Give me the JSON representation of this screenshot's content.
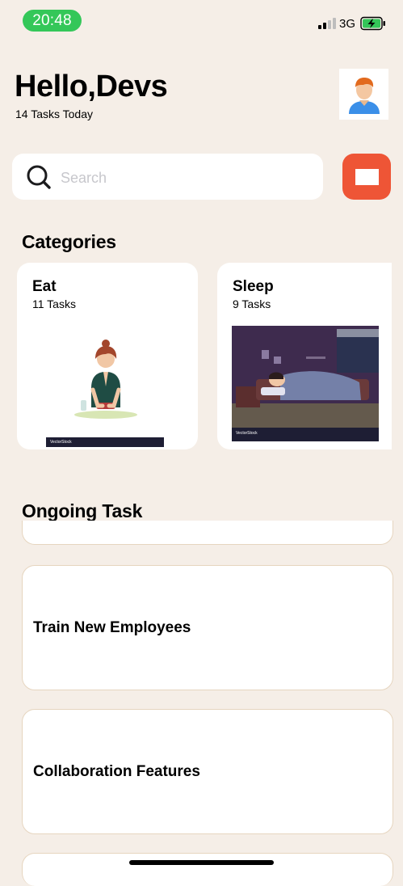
{
  "status_bar": {
    "time": "20:48",
    "network": "3G"
  },
  "header": {
    "greeting": "Hello,Devs",
    "subtitle": "14 Tasks Today"
  },
  "search": {
    "placeholder": "Search",
    "value": ""
  },
  "categories": {
    "title": "Categories",
    "items": [
      {
        "name": "Eat",
        "count": "11 Tasks",
        "watermark": "VectorStock"
      },
      {
        "name": "Sleep",
        "count": "9 Tasks",
        "watermark": "VectorStock"
      }
    ]
  },
  "ongoing": {
    "title": "Ongoing Task",
    "items": [
      {
        "title": "Train New Employees"
      },
      {
        "title": "Collaboration Features"
      }
    ]
  },
  "colors": {
    "background": "#F5EEE7",
    "accent": "#EE5536",
    "time_pill": "#34C759",
    "card_border": "#E6D5BF"
  }
}
